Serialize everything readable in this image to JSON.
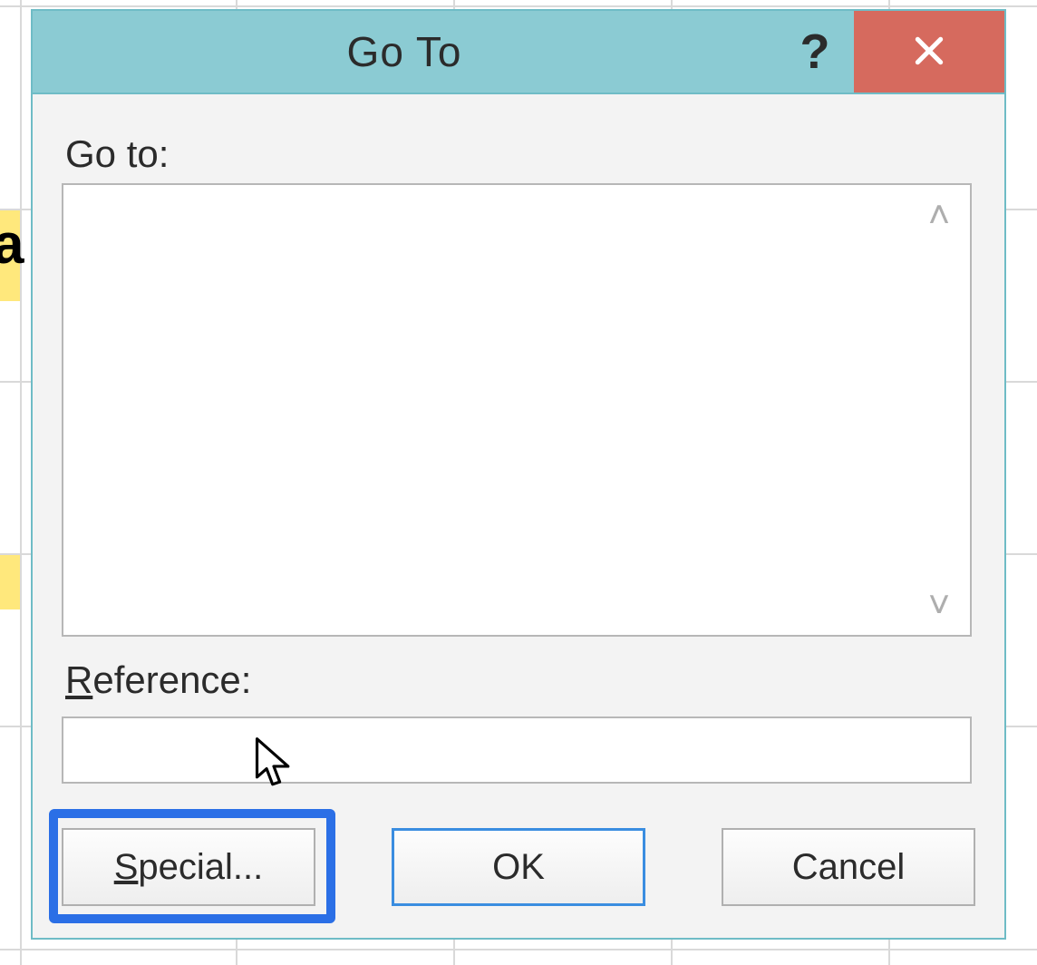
{
  "dialog": {
    "title": "Go To",
    "labels": {
      "goto": "Go to:",
      "reference": "Reference:"
    },
    "reference_value": "",
    "buttons": {
      "special": "Special...",
      "ok": "OK",
      "cancel": "Cancel"
    }
  },
  "icons": {
    "help": "?",
    "close": "close-icon",
    "scroll_up": "˄",
    "scroll_down": "˅"
  },
  "sheet": {
    "partial_text": "a"
  }
}
